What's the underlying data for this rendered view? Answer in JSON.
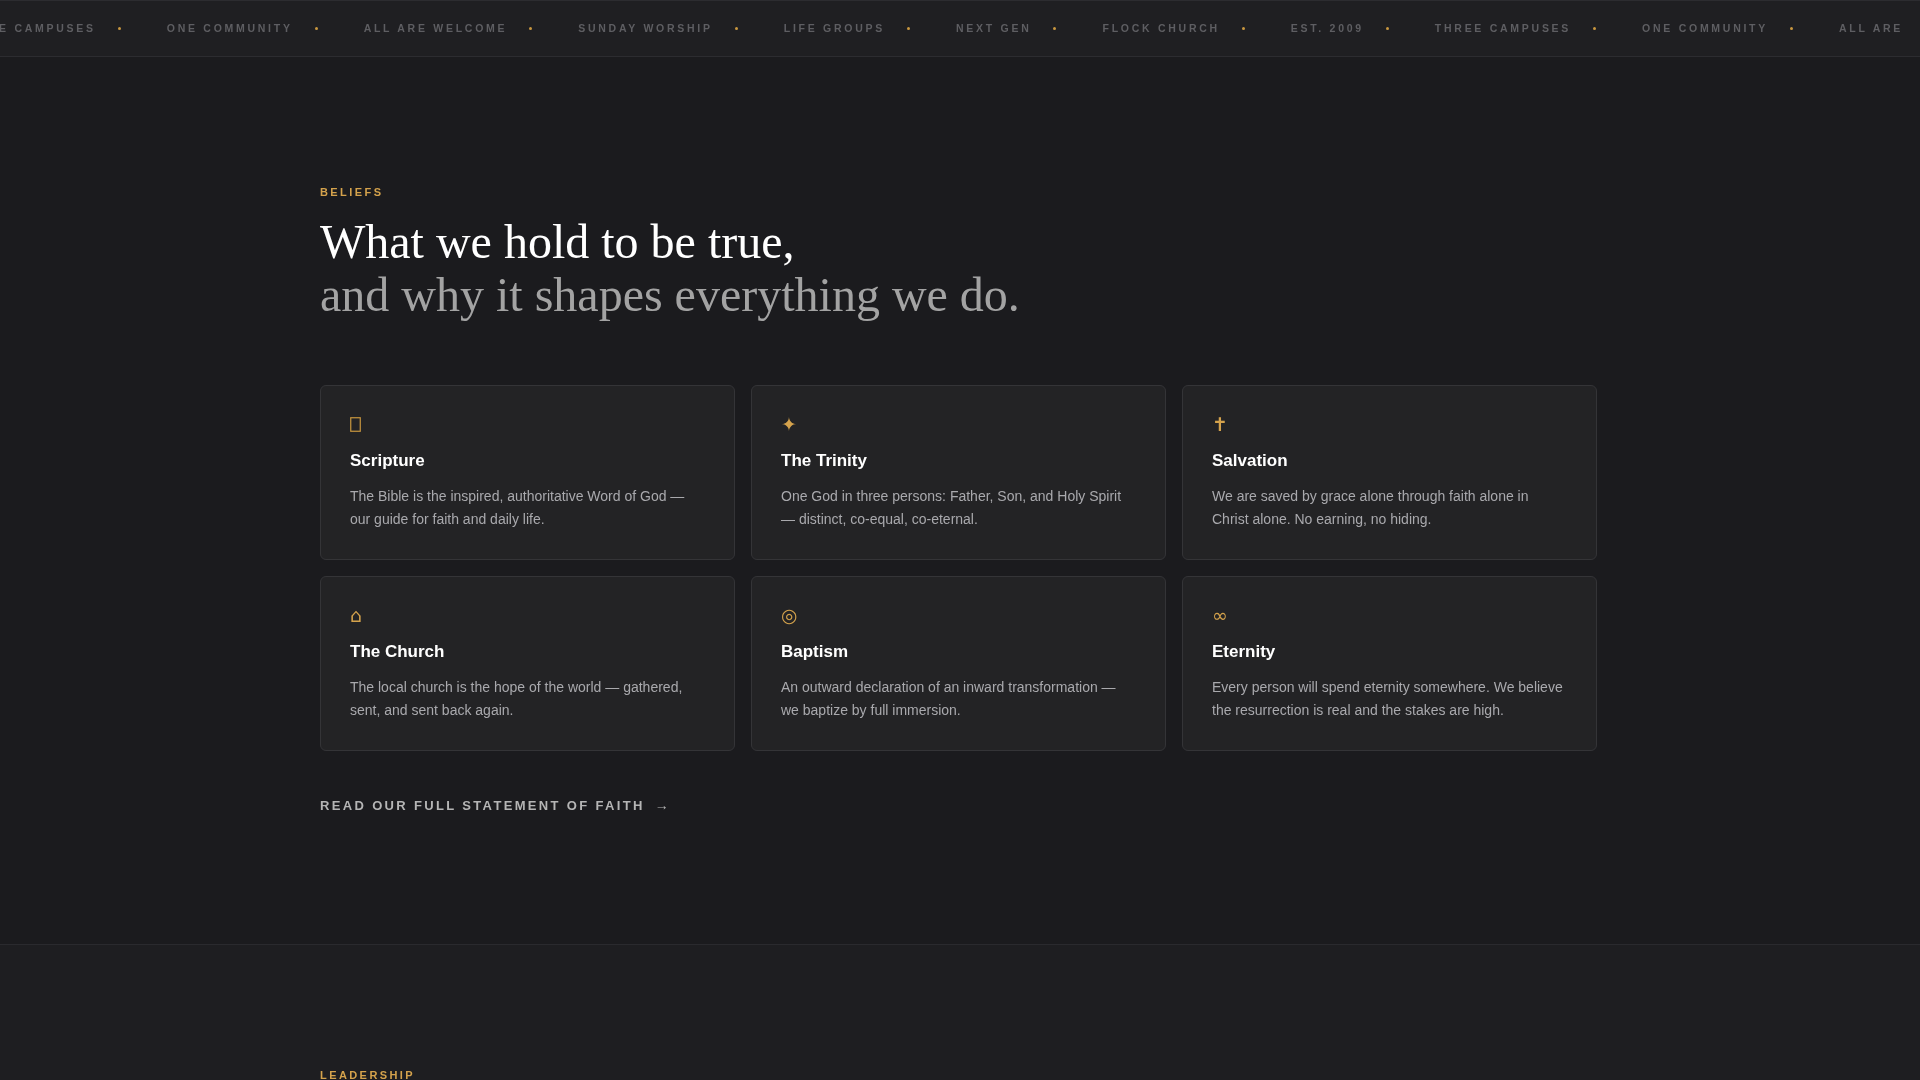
{
  "ticker": [
    "E CAMPUSES",
    "ONE COMMUNITY",
    "ALL ARE WELCOME",
    "SUNDAY WORSHIP",
    "LIFE GROUPS",
    "NEXT GEN",
    "FLOCK CHURCH",
    "EST. 2009",
    "THREE CAMPUSES",
    "ONE COMMUNITY",
    "ALL ARE"
  ],
  "beliefs": {
    "eyebrow": "BELIEFS",
    "heading": "What we hold to be true,",
    "subheading": "and why it shapes everything we do.",
    "cards": [
      {
        "icon": {
          "kind": "box"
        },
        "title": "Scripture",
        "text": "The Bible is the inspired, authoritative Word of God — our guide for faith and daily life."
      },
      {
        "icon": {
          "kind": "sparkle",
          "char": "✦"
        },
        "title": "The Trinity",
        "text": "One God in three persons: Father, Son, and Holy Spirit — distinct, co-equal, co-eternal."
      },
      {
        "icon": {
          "kind": "cross",
          "char": "✝"
        },
        "title": "Salvation",
        "text": "We are saved by grace alone through faith alone in Christ alone. No earning, no hiding."
      },
      {
        "icon": {
          "kind": "house",
          "char": "⌂"
        },
        "title": "The Church",
        "text": "The local church is the hope of the world — gathered, sent, and sent back again."
      },
      {
        "icon": {
          "kind": "target",
          "char": "◎"
        },
        "title": "Baptism",
        "text": "An outward declaration of an inward transformation — we baptize by full immersion."
      },
      {
        "icon": {
          "kind": "infinity",
          "char": "∞"
        },
        "title": "Eternity",
        "text": "Every person will spend eternity somewhere. We believe the resurrection is real and the stakes are high."
      }
    ],
    "link": {
      "label": "READ OUR FULL STATEMENT OF FAITH",
      "arrow": "→"
    }
  },
  "leadership": {
    "eyebrow": "LEADERSHIP"
  }
}
